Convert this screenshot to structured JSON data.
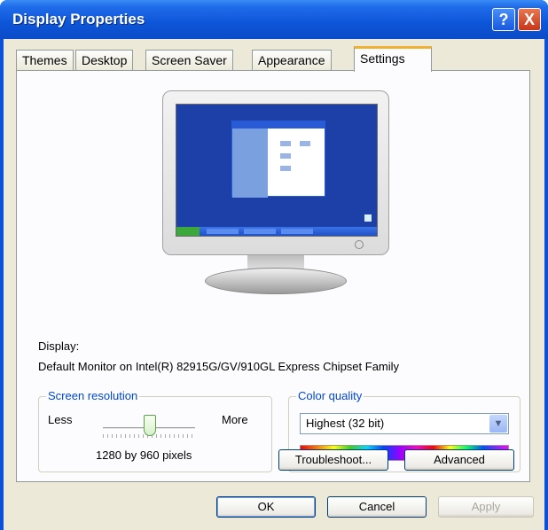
{
  "window": {
    "title": "Display Properties"
  },
  "titlebar_buttons": {
    "help": "?",
    "close": "X"
  },
  "tabs": [
    {
      "label": "Themes",
      "active": false
    },
    {
      "label": "Desktop",
      "active": false
    },
    {
      "label": "Screen Saver",
      "active": false
    },
    {
      "label": "Appearance",
      "active": false
    },
    {
      "label": "Settings",
      "active": true
    }
  ],
  "display": {
    "label": "Display:",
    "monitor_name": "Default Monitor on Intel(R) 82915G/GV/910GL Express Chipset Family"
  },
  "screen_resolution": {
    "group_title": "Screen resolution",
    "less_label": "Less",
    "more_label": "More",
    "value": "1280 by 960 pixels"
  },
  "color_quality": {
    "group_title": "Color quality",
    "selected": "Highest (32 bit)"
  },
  "buttons": {
    "troubleshoot": "Troubleshoot...",
    "advanced": "Advanced",
    "ok": "OK",
    "cancel": "Cancel",
    "apply": "Apply"
  },
  "colors": {
    "title_bar": "#0a50d8",
    "dialog_bg": "#ece9d8",
    "group_title": "#0046d5",
    "active_tab_accent": "#f0b035"
  }
}
